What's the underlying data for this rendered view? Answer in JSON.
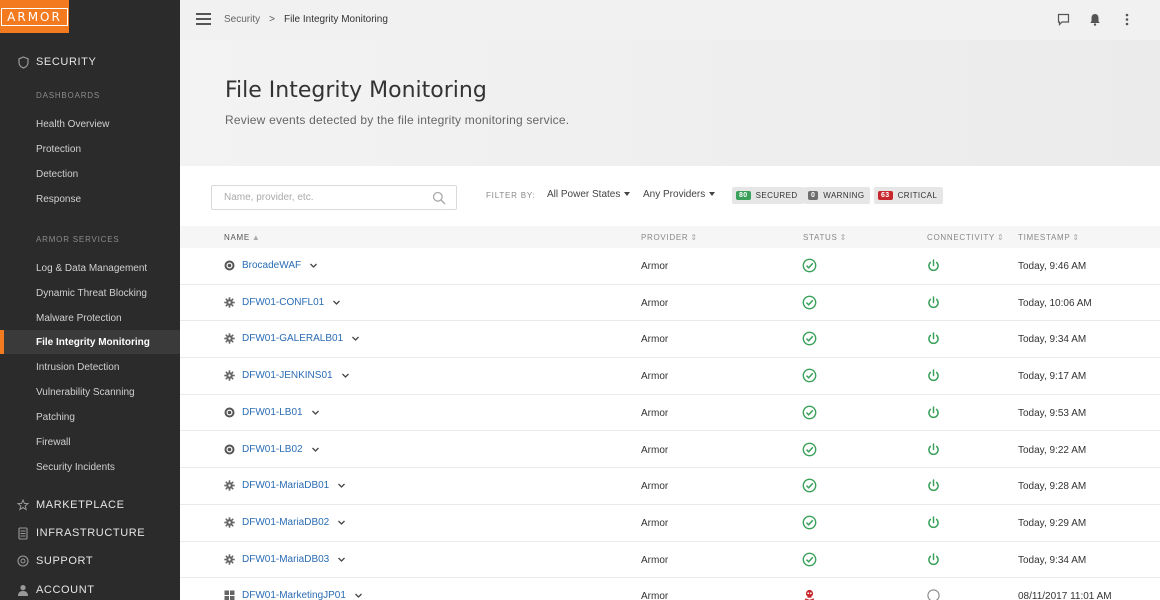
{
  "brand": {
    "logo_text": "ARMOR"
  },
  "sidebar": {
    "security": "SECURITY",
    "dashboards_head": "DASHBOARDS",
    "dashboards": [
      "Health Overview",
      "Protection",
      "Detection",
      "Response"
    ],
    "services_head": "ARMOR SERVICES",
    "services": [
      "Log & Data Management",
      "Dynamic Threat Blocking",
      "Malware Protection",
      "File Integrity Monitoring",
      "Intrusion Detection",
      "Vulnerability Scanning",
      "Patching",
      "Firewall",
      "Security Incidents"
    ],
    "active_item": "File Integrity Monitoring",
    "marketplace": "MARKETPLACE",
    "infrastructure": "INFRASTRUCTURE",
    "support": "SUPPORT",
    "account": "ACCOUNT"
  },
  "breadcrumb": {
    "parent": "Security",
    "separator": ">",
    "current": "File Integrity Monitoring"
  },
  "page": {
    "title": "File Integrity Monitoring",
    "subtitle": "Review events detected by the file integrity monitoring service."
  },
  "filters": {
    "search_placeholder": "Name, provider, etc.",
    "filter_by": "FILTER BY:",
    "power_states": "All Power States",
    "providers": "Any Providers",
    "badges": [
      {
        "count": "80",
        "label": "SECURED",
        "color": "#3aa05a"
      },
      {
        "count": "0",
        "label": "WARNING",
        "color": "#6f6f6f"
      },
      {
        "count": "63",
        "label": "CRITICAL",
        "color": "#c8282d"
      }
    ]
  },
  "table": {
    "headers": {
      "name": "NAME",
      "provider": "PROVIDER",
      "status": "STATUS",
      "connectivity": "CONNECTIVITY",
      "timestamp": "TIMESTAMP"
    },
    "rows": [
      {
        "name": "BrocadeWAF",
        "os": "ubuntu",
        "provider": "Armor",
        "status": "secured",
        "connectivity": "online",
        "timestamp": "Today, 9:46 AM"
      },
      {
        "name": "DFW01-CONFL01",
        "os": "gear",
        "provider": "Armor",
        "status": "secured",
        "connectivity": "online",
        "timestamp": "Today, 10:06 AM"
      },
      {
        "name": "DFW01-GALERALB01",
        "os": "gear",
        "provider": "Armor",
        "status": "secured",
        "connectivity": "online",
        "timestamp": "Today, 9:34 AM"
      },
      {
        "name": "DFW01-JENKINS01",
        "os": "gear",
        "provider": "Armor",
        "status": "secured",
        "connectivity": "online",
        "timestamp": "Today, 9:17 AM"
      },
      {
        "name": "DFW01-LB01",
        "os": "ubuntu",
        "provider": "Armor",
        "status": "secured",
        "connectivity": "online",
        "timestamp": "Today, 9:53 AM"
      },
      {
        "name": "DFW01-LB02",
        "os": "ubuntu",
        "provider": "Armor",
        "status": "secured",
        "connectivity": "online",
        "timestamp": "Today, 9:22 AM"
      },
      {
        "name": "DFW01-MariaDB01",
        "os": "gear",
        "provider": "Armor",
        "status": "secured",
        "connectivity": "online",
        "timestamp": "Today, 9:28 AM"
      },
      {
        "name": "DFW01-MariaDB02",
        "os": "gear",
        "provider": "Armor",
        "status": "secured",
        "connectivity": "online",
        "timestamp": "Today, 9:29 AM"
      },
      {
        "name": "DFW01-MariaDB03",
        "os": "gear",
        "provider": "Armor",
        "status": "secured",
        "connectivity": "online",
        "timestamp": "Today, 9:34 AM"
      },
      {
        "name": "DFW01-MarketingJP01",
        "os": "windows",
        "provider": "Armor",
        "status": "critical",
        "connectivity": "offline",
        "timestamp": "08/11/2017 11:01 AM"
      }
    ]
  },
  "colors": {
    "accent": "#f47a20",
    "link": "#2a6cb5",
    "ok": "#3aa05a",
    "critical": "#c8282d"
  }
}
